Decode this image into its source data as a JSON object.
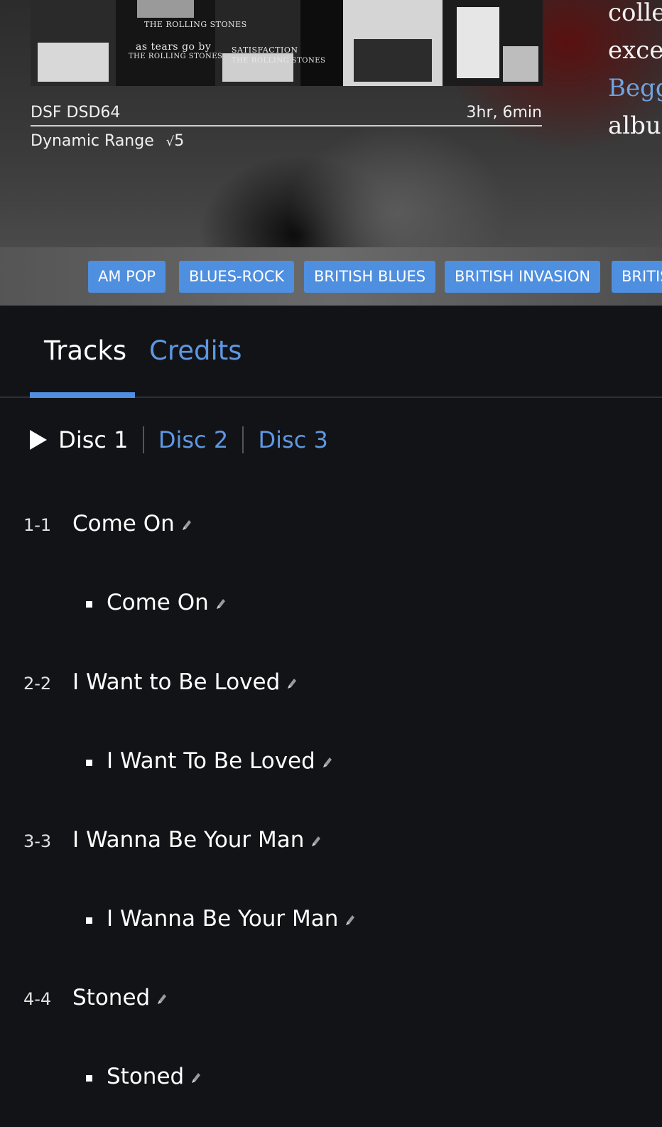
{
  "album": {
    "cover_captions": [
      "THE ROLLING STONES",
      "as tears go by",
      "THE ROLLING STONES",
      "SATISFACTION",
      "THE ROLLING STONES"
    ],
    "format": "DSF DSD64",
    "duration": "3hr, 6min",
    "dynamic_range_label": "Dynamic Range",
    "dynamic_range_value": "5",
    "dynamic_range_icon": "waveform-icon",
    "description_lines": [
      "colle",
      "exce",
      "Begg",
      "albu"
    ]
  },
  "genres": [
    "AM POP",
    "BLUES-ROCK",
    "BRITISH BLUES",
    "BRITISH INVASION",
    "BRITIS"
  ],
  "tabs": {
    "tracks": "Tracks",
    "credits": "Credits"
  },
  "discs": {
    "play_icon": "play-icon",
    "items": [
      "Disc 1",
      "Disc 2",
      "Disc 3"
    ]
  },
  "tracks": [
    {
      "num": "1-1",
      "title": "Come On",
      "work": "Come On"
    },
    {
      "num": "2-2",
      "title": "I Want to Be Loved",
      "work": "I Want To Be Loved"
    },
    {
      "num": "3-3",
      "title": "I Wanna Be Your Man",
      "work": "I Wanna Be Your Man"
    },
    {
      "num": "4-4",
      "title": "Stoned",
      "work": "Stoned"
    }
  ],
  "colors": {
    "accent": "#4f8fe0",
    "link": "#5e98e2",
    "background": "#121317"
  }
}
